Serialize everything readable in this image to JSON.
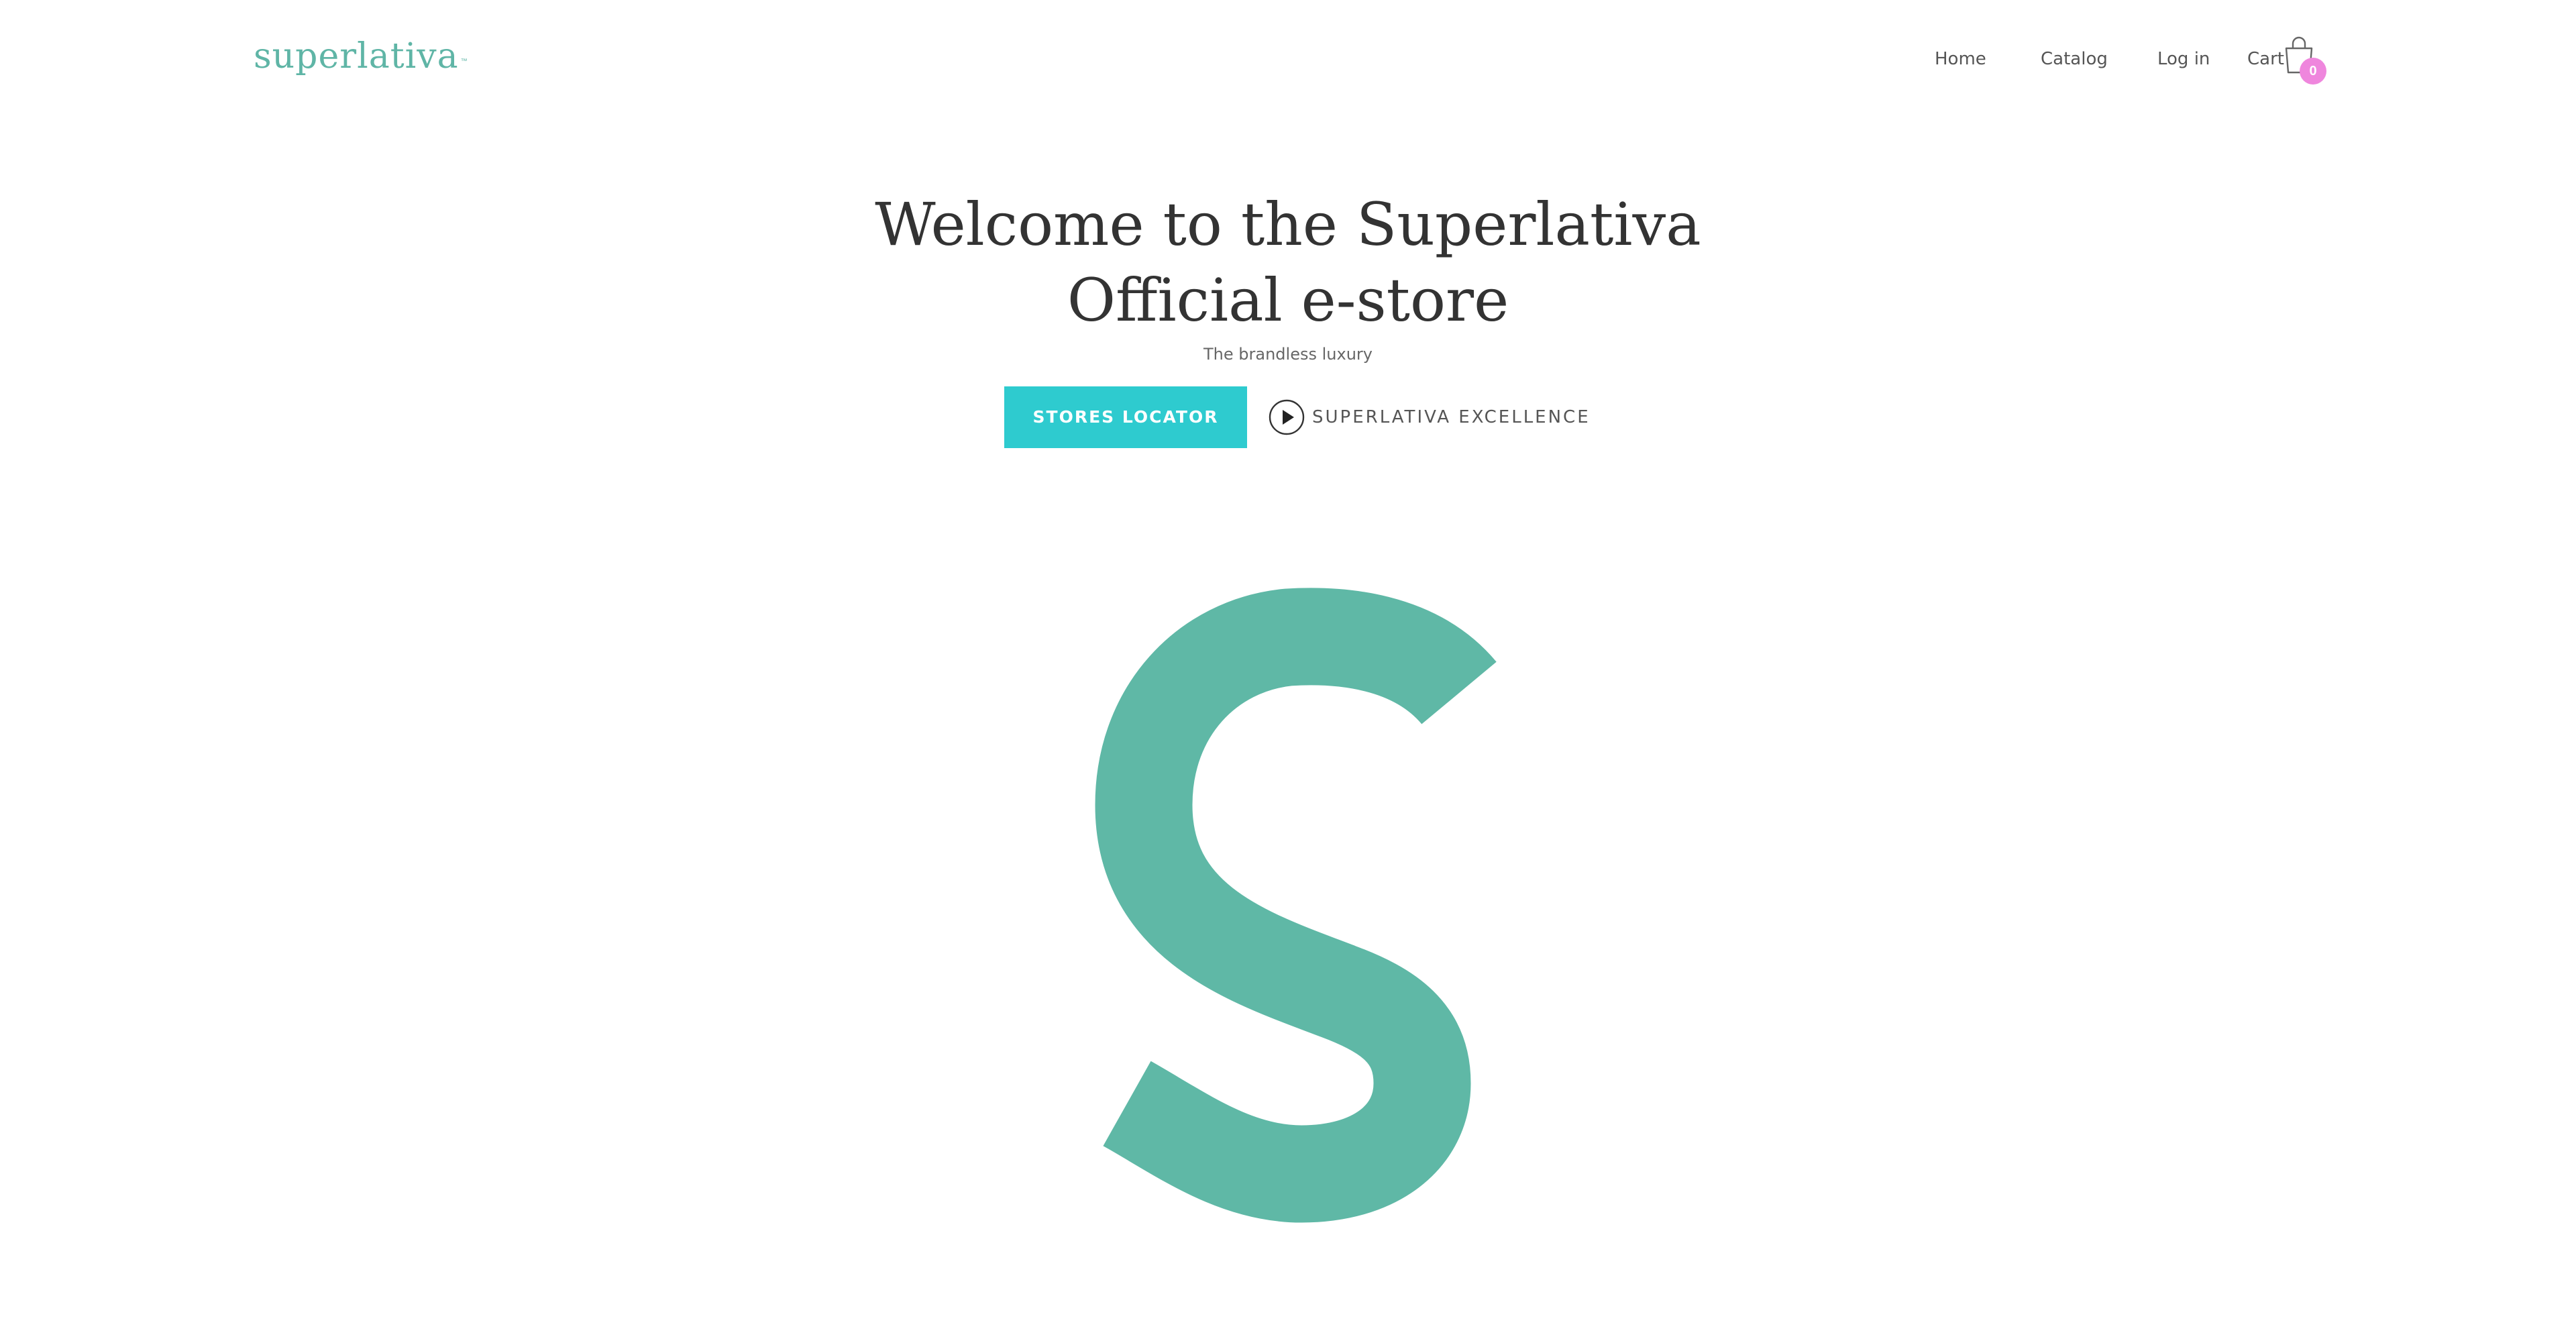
{
  "brand": {
    "logo_text": "superlativa",
    "logo_tm": "™",
    "brand_color": "#5fb5a6"
  },
  "nav": {
    "home": "Home",
    "catalog": "Catalog",
    "login": "Log in",
    "cart": "Cart",
    "cart_count": "0",
    "cart_icon": "shopping-bag-icon",
    "badge_color": "#ef86dd"
  },
  "hero": {
    "title": "Welcome to the Superlativa Official e-store",
    "subtitle": "The brandless luxury",
    "locator_button": "STORES LOCATOR",
    "locator_color": "#2ecbcf",
    "video_link": "SUPERLATIVA EXCELLENCE",
    "video_icon": "play-circle-icon"
  },
  "emblem": {
    "icon": "superlativa-s-logo-icon",
    "color": "#5fb5a6"
  }
}
